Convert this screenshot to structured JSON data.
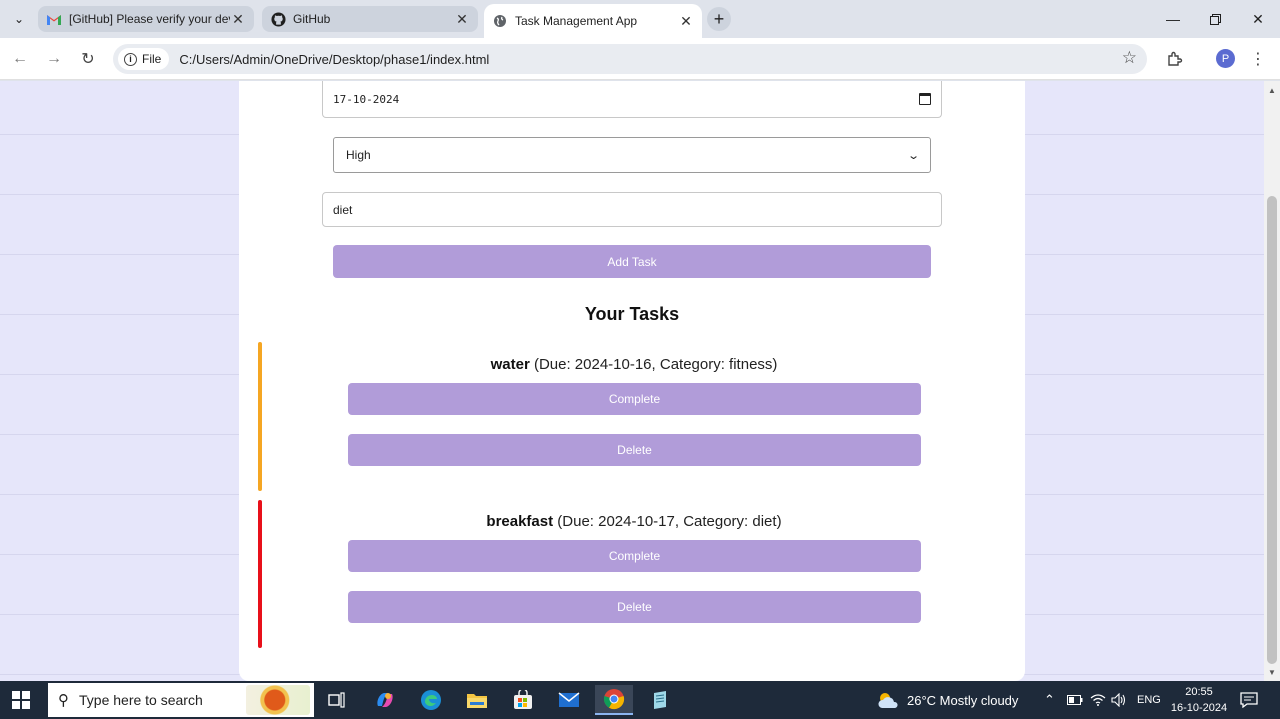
{
  "browser": {
    "tabs": [
      {
        "title": "[GitHub] Please verify your devi",
        "icon": "gmail-icon",
        "active": false
      },
      {
        "title": "GitHub",
        "icon": "github-icon",
        "active": false
      },
      {
        "title": "Task Management App",
        "icon": "globe-icon",
        "active": true
      }
    ],
    "url_chip": "File",
    "url": "C:/Users/Admin/OneDrive/Desktop/phase1/index.html",
    "profile_initial": "P"
  },
  "form": {
    "date_value": "17-10-2024",
    "priority_selected": "High",
    "category_value": "diet",
    "add_button": "Add Task"
  },
  "tasks_section": {
    "title": "Your Tasks",
    "tasks": [
      {
        "name": "water",
        "details": " (Due: 2024-10-16, Category: fitness)",
        "priority_color": "#f5a623",
        "complete_label": "Complete",
        "delete_label": "Delete"
      },
      {
        "name": "breakfast",
        "details": " (Due: 2024-10-17, Category: diet)",
        "priority_color": "#e8101a",
        "complete_label": "Complete",
        "delete_label": "Delete"
      }
    ]
  },
  "taskbar": {
    "search_placeholder": "Type here to search",
    "weather": "26°C  Mostly cloudy",
    "language": "ENG",
    "time": "20:55",
    "date": "16-10-2024"
  },
  "colors": {
    "page_bg": "#e6e6fa",
    "button": "#b19cd9"
  }
}
